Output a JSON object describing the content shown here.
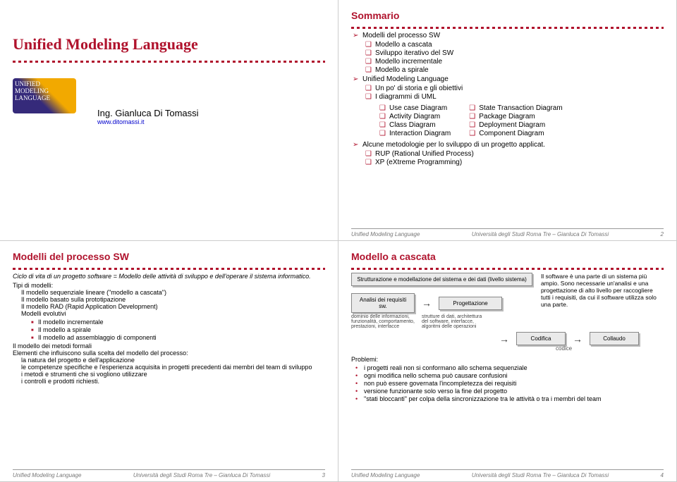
{
  "footer": {
    "left": "Unified Modeling Language",
    "mid": "Università degli Studi Roma Tre – Gianluca Di Tomassi"
  },
  "slide1": {
    "title": "Unified Modeling Language",
    "author": "Ing. Gianluca Di Tomassi",
    "site": "www.ditomassi.it",
    "logo_lines": [
      "UNIFIED",
      "MODELING",
      "LANGUAGE"
    ]
  },
  "slide2": {
    "title": "Sommario",
    "top": [
      "Modelli del processo SW",
      "Modello a cascata",
      "Sviluppo iterativo del SW",
      "Modello incrementale",
      "Modello a spirale"
    ],
    "uml_head": "Unified Modeling Language",
    "uml_sub": [
      "Un po' di storia e gli obiettivi",
      "I diagrammi di UML"
    ],
    "diag_l": [
      "Use case Diagram",
      "Activity Diagram",
      "Class Diagram",
      "Interaction Diagram"
    ],
    "diag_r": [
      "State Transaction Diagram",
      "Package Diagram",
      "Deployment Diagram",
      "Component Diagram"
    ],
    "method": "Alcune metodologie per lo sviluppo di un progetto applicat.",
    "method_sub": [
      "RUP (Rational Unified Process)",
      "XP   (eXtreme Programming)"
    ],
    "page": "2"
  },
  "slide3": {
    "title": "Modelli del processo SW",
    "intro": "Ciclo di vita di un progetto software = Modello delle attività di sviluppo e dell'operare il sistema informatico.",
    "tipi": "Tipi di modelli:",
    "tipi_items": [
      "Il modello sequenziale lineare (\"modello a cascata\")",
      "Il modello basato sulla prototipazione",
      "Il modello RAD (Rapid Application Development)",
      "Modelli evolutivi"
    ],
    "evo_items": [
      "Il modello  incrementale",
      "Il modello a spirale",
      "Il modello ad assemblaggio di componenti"
    ],
    "formal": "Il modello dei metodi formali",
    "elem_head": "Elementi che influiscono sulla scelta del modello del processo:",
    "elem_items": [
      "la natura del progetto e dell'applicazione",
      "le competenze specifiche e l'esperienza acquisita in progetti precedenti dai membri del team di sviluppo",
      "i metodi e strumenti che si vogliono utilizzare",
      "i controlli e prodotti richiesti."
    ],
    "page": "3"
  },
  "slide4": {
    "title": "Modello a cascata",
    "side": "Il software è una parte di un sistema più ampio. Sono necessarie un'analisi e una progettazione di alto livello per raccogliere tutti i requisiti, da cui il software utilizza solo una parte.",
    "box1": "Strutturazione e modellazione del sistema e dei dati (livello sistema)",
    "box2": "Analisi dei requisiti sw.",
    "box3": "Progettazione",
    "box4": "Codifica",
    "box5": "Collaudo",
    "cap1": "dominio delle informazioni, funzionalità, comportamento, prestazioni, interfacce",
    "cap2": "strutture di dati, architettura del software, interfacce, algoritmi delle operazioni",
    "cap3": "codice",
    "prob": "Problemi:",
    "prob_items": [
      "i progetti reali non si conformano allo schema sequenziale",
      "ogni modifica nello schema può causare confusioni",
      "non può essere governata l'incompletezza dei requisiti",
      "versione funzionante solo verso la fine del progetto",
      "\"stati bloccanti\" per colpa della sincronizzazione tra le attività o tra i membri del team"
    ],
    "page": "4"
  }
}
